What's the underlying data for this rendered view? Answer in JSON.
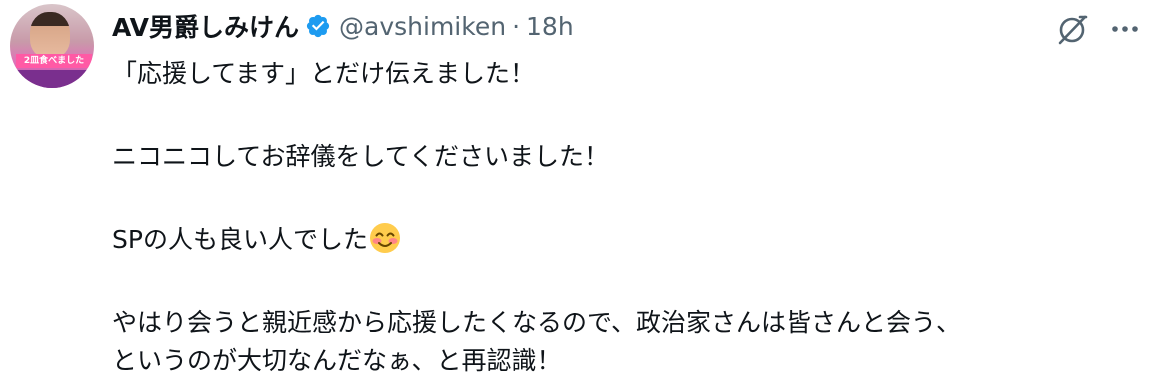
{
  "tweet": {
    "display_name": "AV男爵しみけん",
    "handle": "@avshimiken",
    "separator": "·",
    "time": "18h",
    "avatar_caption": "2皿食べました",
    "icons": {
      "verified": "verified-badge-icon",
      "grok": "grok-icon",
      "more": "more-icon",
      "emoji": "smiling-face-with-smiling-eyes-emoji"
    },
    "colors": {
      "verified": "#1d9bf0",
      "text": "#0f1419",
      "secondary": "#536471"
    },
    "body": {
      "line1": "「応援してます」とだけ伝えました！",
      "line2": "ニコニコしてお辞儀をしてくださいました！",
      "line3": "SPの人も良い人でした",
      "line4": "やはり会うと親近感から応援したくなるので、政治家さんは皆さんと会う、",
      "line5": "というのが大切なんだなぁ、と再認識！"
    }
  }
}
